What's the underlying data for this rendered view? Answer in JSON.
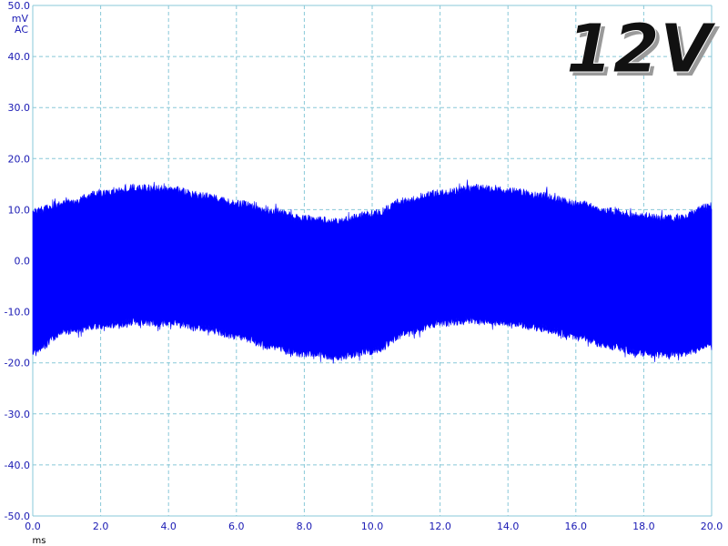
{
  "chart_data": {
    "type": "area",
    "x_unit": "ms",
    "y_unit": "mV",
    "y_coupling": "AC",
    "xlim": [
      0.0,
      20.0
    ],
    "ylim": [
      -50.0,
      50.0
    ],
    "x_ticks": [
      "0.0",
      "2.0",
      "4.0",
      "6.0",
      "8.0",
      "10.0",
      "12.0",
      "14.0",
      "16.0",
      "18.0",
      "20.0"
    ],
    "y_ticks": [
      "50.0",
      "40.0",
      "30.0",
      "20.0",
      "10.0",
      "0.0",
      "-10.0",
      "-20.0",
      "-30.0",
      "-40.0",
      "-50.0"
    ],
    "grid": true,
    "annotation": "12V",
    "series": [
      {
        "color": "#0000ff",
        "x": [
          0.0,
          1.0,
          2.0,
          3.0,
          4.0,
          5.0,
          6.0,
          7.0,
          8.0,
          9.0,
          10.0,
          11.0,
          12.0,
          13.0,
          14.0,
          15.0,
          16.0,
          17.0,
          18.0,
          19.0,
          20.0
        ],
        "upper": [
          10.5,
          12.0,
          14.0,
          15.0,
          14.8,
          13.5,
          12.0,
          10.5,
          9.0,
          8.5,
          10.0,
          12.5,
          14.0,
          15.0,
          14.5,
          13.5,
          12.0,
          10.5,
          9.5,
          9.0,
          11.5
        ],
        "lower": [
          -18.5,
          -14.5,
          -13.5,
          -12.8,
          -13.0,
          -14.0,
          -15.5,
          -17.5,
          -19.0,
          -19.5,
          -18.5,
          -15.0,
          -13.0,
          -12.5,
          -13.0,
          -14.0,
          -15.5,
          -17.5,
          -19.0,
          -19.0,
          -17.5
        ]
      }
    ]
  },
  "colors": {
    "trace": "#0000ff",
    "grid": "#88c8d8",
    "tick_text": "#1a1ab4",
    "annotation_fill": "#111111"
  }
}
